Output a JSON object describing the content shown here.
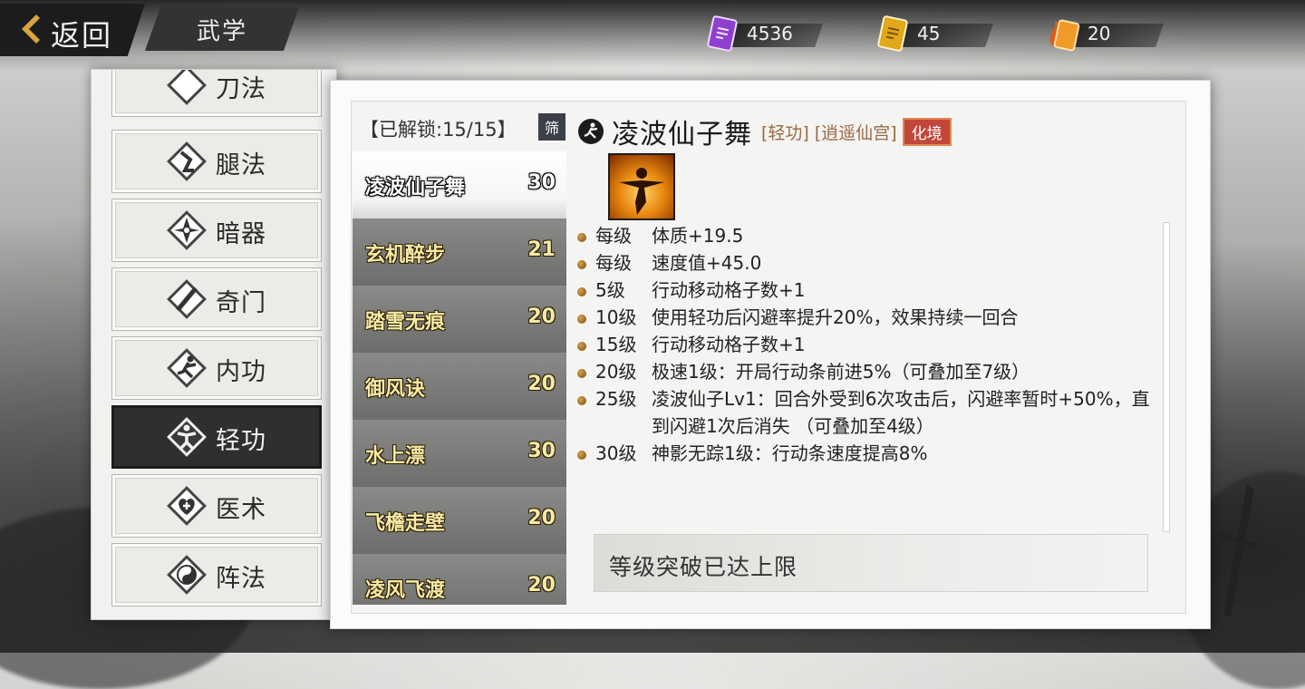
{
  "header": {
    "back_label": "返回",
    "title": "武学",
    "currencies": [
      {
        "icon": "purple-scroll-icon",
        "value": "4536",
        "color": "#9b4bd8"
      },
      {
        "icon": "gold-scroll-icon",
        "value": "45",
        "color": "#e0a81a"
      },
      {
        "icon": "fire-scroll-icon",
        "value": "20",
        "color": "#e86a12"
      }
    ]
  },
  "categories": [
    {
      "label": "刀法",
      "icon": "blade-icon"
    },
    {
      "label": "腿法",
      "icon": "kick-icon"
    },
    {
      "label": "暗器",
      "icon": "shuriken-icon"
    },
    {
      "label": "奇门",
      "icon": "scroll-staff-icon"
    },
    {
      "label": "内功",
      "icon": "martial-pose-icon"
    },
    {
      "label": "轻功",
      "icon": "leaping-figure-icon",
      "active": true
    },
    {
      "label": "医术",
      "icon": "heart-cross-icon"
    },
    {
      "label": "阵法",
      "icon": "yin-yang-icon"
    }
  ],
  "skills_panel": {
    "unlock_label": "【已解锁:15/15】",
    "filter_label": "筛",
    "skills": [
      {
        "name": "凌波仙子舞",
        "level": "30",
        "active": true
      },
      {
        "name": "玄机醉步",
        "level": "21"
      },
      {
        "name": "踏雪无痕",
        "level": "20"
      },
      {
        "name": "御风诀",
        "level": "20"
      },
      {
        "name": "水上漂",
        "level": "30"
      },
      {
        "name": "飞檐走壁",
        "level": "20"
      },
      {
        "name": "凌风飞渡",
        "level": "20"
      }
    ]
  },
  "detail": {
    "title": "凌波仙子舞",
    "type_tag": "[轻功]",
    "sect_tag": "[逍遥仙宫]",
    "realm_badge": "化境",
    "effects": [
      {
        "level": "每级",
        "text": "体质+19.5"
      },
      {
        "level": "每级",
        "text": "速度值+45.0"
      },
      {
        "level": "5级",
        "text": "行动移动格子数+1"
      },
      {
        "level": "10级",
        "text": "使用轻功后闪避率提升20%，效果持续一回合"
      },
      {
        "level": "15级",
        "text": "行动移动格子数+1"
      },
      {
        "level": "20级",
        "text": "极速1级：开局行动条前进5%（可叠加至7级）"
      },
      {
        "level": "25级",
        "text": "凌波仙子Lv1：回合外受到6次攻击后，闪避率暂时+50%，直到闪避1次后消失  （可叠加至4级）"
      },
      {
        "level": "30级",
        "text": "神影无踪1级：行动条速度提高8%"
      }
    ],
    "limit_text": "等级突破已达上限"
  }
}
